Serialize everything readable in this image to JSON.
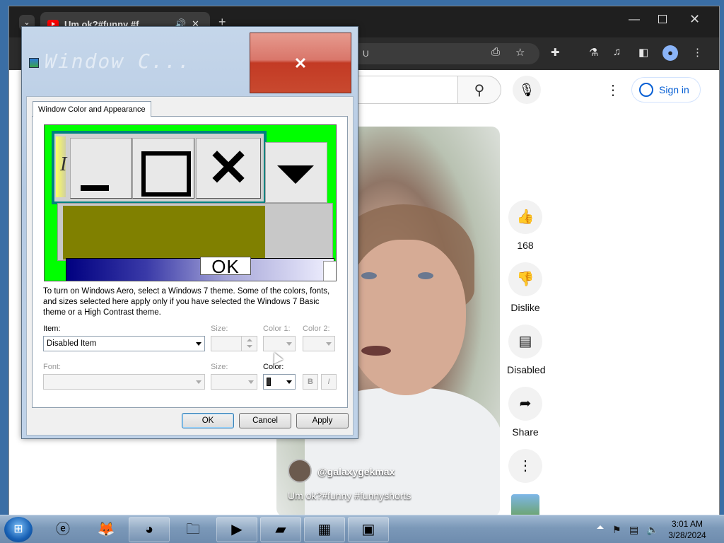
{
  "browser": {
    "tab_title": "Um ok?#funny #f",
    "tab_audio_icon": "speaker-icon",
    "tab_close_icon": "close-icon",
    "new_tab_icon": "plus-icon",
    "omnibox_text": "U"
  },
  "youtube": {
    "sign_in": "Sign in",
    "actions": {
      "like_count": "168",
      "dislike": "Dislike",
      "comments": "Disabled",
      "share": "Share"
    },
    "channel": "@galaxygekmax",
    "video_title": "Um ok?#funny #funnyshorts"
  },
  "dialog": {
    "title": "Window C...",
    "tab": "Window Color and Appearance",
    "preview": {
      "italic_text": "I",
      "ok_text": "OK"
    },
    "note": "To turn on Windows Aero, select a Windows 7 theme.  Some of the colors, fonts, and sizes selected here apply only if you have selected the Windows 7 Basic theme or a High Contrast theme.",
    "labels": {
      "item": "Item:",
      "size": "Size:",
      "color1": "Color 1:",
      "color2": "Color 2:",
      "font": "Font:",
      "font_size": "Size:",
      "color": "Color:"
    },
    "item_value": "Disabled Item",
    "bold_btn": "B",
    "italic_btn": "I",
    "buttons": {
      "ok": "OK",
      "cancel": "Cancel",
      "apply": "Apply"
    }
  },
  "taskbar": {
    "clock_time": "3:01 AM",
    "clock_date": "3/28/2024"
  }
}
